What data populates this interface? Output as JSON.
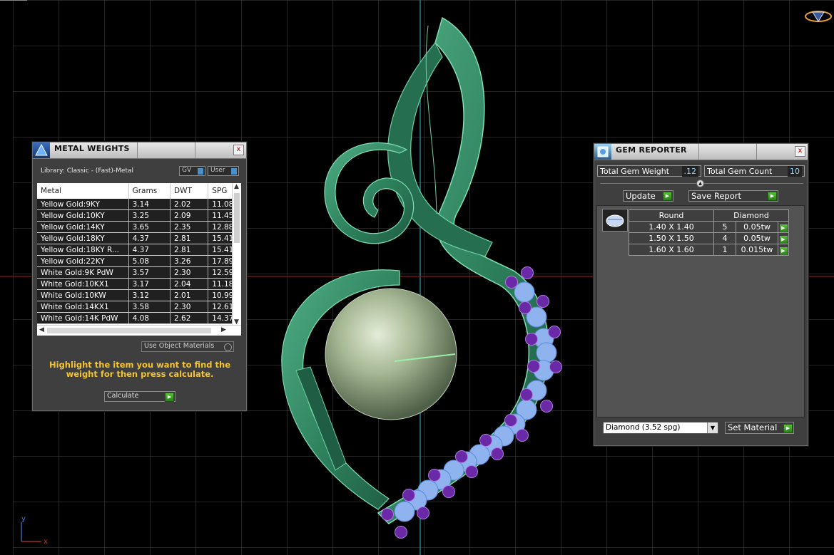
{
  "viewport": {
    "axis_y_label": "y",
    "axis_x_label": "x"
  },
  "metal_weights": {
    "title": "METAL WEIGHTS",
    "close_label": "x",
    "library": "Library: Classic - (Fast)-Metal",
    "toggle_gv": "GV",
    "toggle_user": "User",
    "columns": [
      "Metal",
      "Grams",
      "DWT",
      "SPG"
    ],
    "rows": [
      [
        "Yellow Gold:9KY",
        "3.14",
        "2.02",
        "11.08"
      ],
      [
        "Yellow Gold:10KY",
        "3.25",
        "2.09",
        "11.45"
      ],
      [
        "Yellow Gold:14KY",
        "3.65",
        "2.35",
        "12.88"
      ],
      [
        "Yellow Gold:18KY",
        "4.37",
        "2.81",
        "15.41"
      ],
      [
        "Yellow Gold:18KY R...",
        "4.37",
        "2.81",
        "15.41"
      ],
      [
        "Yellow Gold:22KY",
        "5.08",
        "3.26",
        "17.89"
      ],
      [
        "White Gold:9K PdW",
        "3.57",
        "2.30",
        "12.59"
      ],
      [
        "White Gold:10KX1",
        "3.17",
        "2.04",
        "11.18"
      ],
      [
        "White Gold:10KW",
        "3.12",
        "2.01",
        "10.99"
      ],
      [
        "White Gold:14KX1",
        "3.58",
        "2.30",
        "12.61"
      ],
      [
        "White Gold:14K PdW",
        "4.08",
        "2.62",
        "14.37"
      ]
    ],
    "use_object_materials": "Use Object Materials",
    "hint": "Highlight the item you want to find the weight for then press calculate.",
    "calculate_label": "Calculate"
  },
  "gem_reporter": {
    "title": "GEM REPORTER",
    "close_label": "x",
    "total_weight_label": "Total Gem Weight",
    "total_weight_value": ".12",
    "total_count_label": "Total Gem Count",
    "total_count_value": "10",
    "update_label": "Update",
    "save_report_label": "Save Report",
    "gem_shape": "Round",
    "gem_material": "Diamond",
    "gems": [
      {
        "size": "1.40 X 1.40",
        "count": "5",
        "weight": "0.05tw"
      },
      {
        "size": "1.50 X 1.50",
        "count": "4",
        "weight": "0.05tw"
      },
      {
        "size": "1.60 X 1.60",
        "count": "1",
        "weight": "0.015tw"
      }
    ],
    "material_select": "Diamond    (3.52 spg)",
    "set_material_label": "Set Material"
  },
  "colors": {
    "pendant": "#2f8a64",
    "pearl": "#a6b894",
    "gem_blue": "#8fb3ee",
    "gem_purple": "#6a2aa8",
    "accent_yellow": "#f4c431",
    "button_green": "#3fa72a"
  }
}
